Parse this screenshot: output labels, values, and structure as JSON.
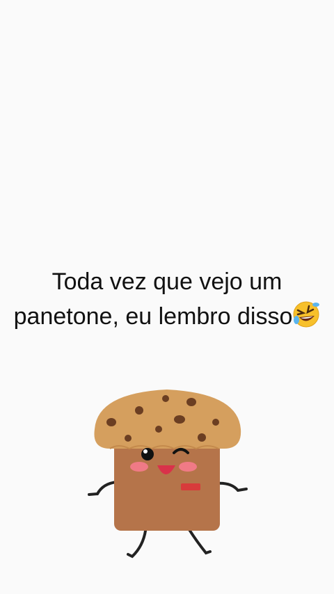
{
  "caption": {
    "line1": "Toda vez que vejo um",
    "line2": "panetone, eu lembro disso"
  },
  "emoji": {
    "name": "rolling-on-floor-laughing-emoji",
    "color": "#f7c02b"
  },
  "mascot": {
    "name": "dancing-panettone-sticker",
    "dome_color": "#d59f5e",
    "body_color": "#b5744a",
    "chip_color": "#6b3e22"
  },
  "colors": {
    "background": "#fafafa",
    "text": "#111111"
  }
}
